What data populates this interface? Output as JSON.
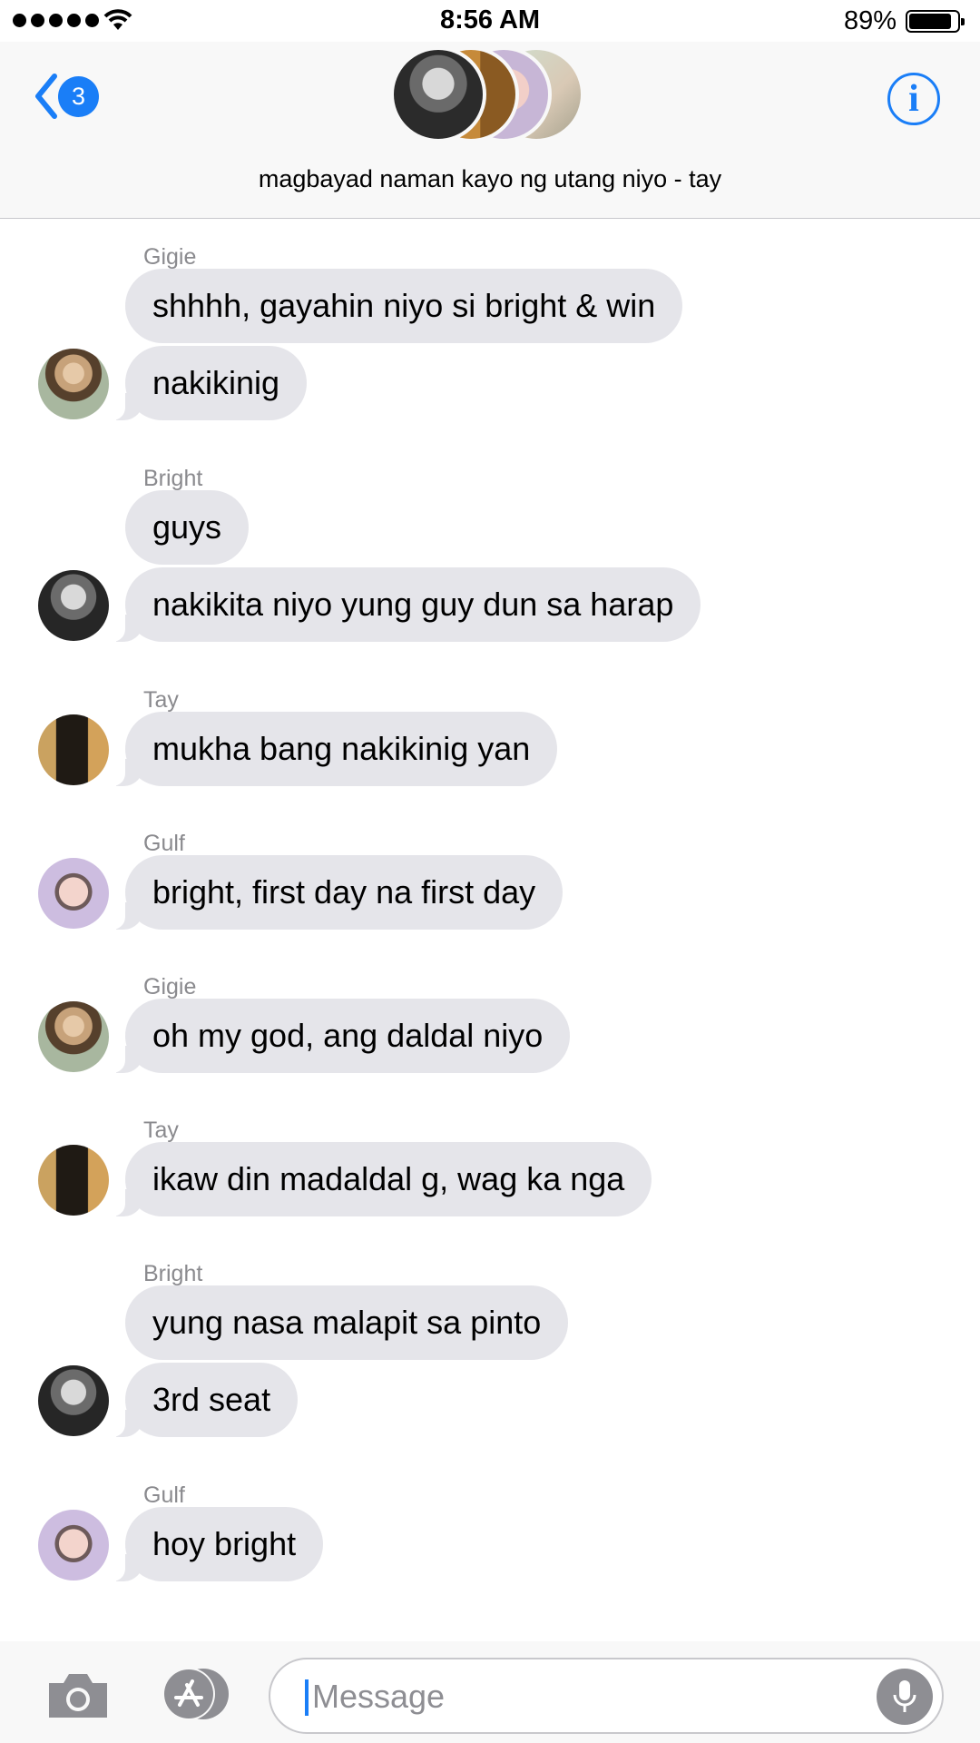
{
  "status_bar": {
    "time": "8:56 AM",
    "battery": "89%"
  },
  "header": {
    "back_count": "3",
    "info_label": "i",
    "group_title": "magbayad naman kayo ng utang niyo - tay"
  },
  "messages": [
    {
      "sender": "Gigie",
      "bubbles": [
        "shhhh, gayahin niyo si bright & win",
        "nakikinig"
      ]
    },
    {
      "sender": "Bright",
      "bubbles": [
        "guys",
        "nakikita niyo yung guy dun sa harap"
      ]
    },
    {
      "sender": "Tay",
      "bubbles": [
        "mukha bang nakikinig yan"
      ]
    },
    {
      "sender": "Gulf",
      "bubbles": [
        "bright, first day na first day"
      ]
    },
    {
      "sender": "Gigie",
      "bubbles": [
        "oh my god, ang daldal niyo"
      ]
    },
    {
      "sender": "Tay",
      "bubbles": [
        "ikaw din madaldal g, wag ka nga"
      ]
    },
    {
      "sender": "Bright",
      "bubbles": [
        "yung nasa malapit sa pinto",
        "3rd seat"
      ]
    },
    {
      "sender": "Gulf",
      "bubbles": [
        "hoy bright"
      ]
    }
  ],
  "input": {
    "placeholder": "Message"
  },
  "colors": {
    "accent": "#1a7ef7",
    "bubble": "#e5e5ea"
  }
}
